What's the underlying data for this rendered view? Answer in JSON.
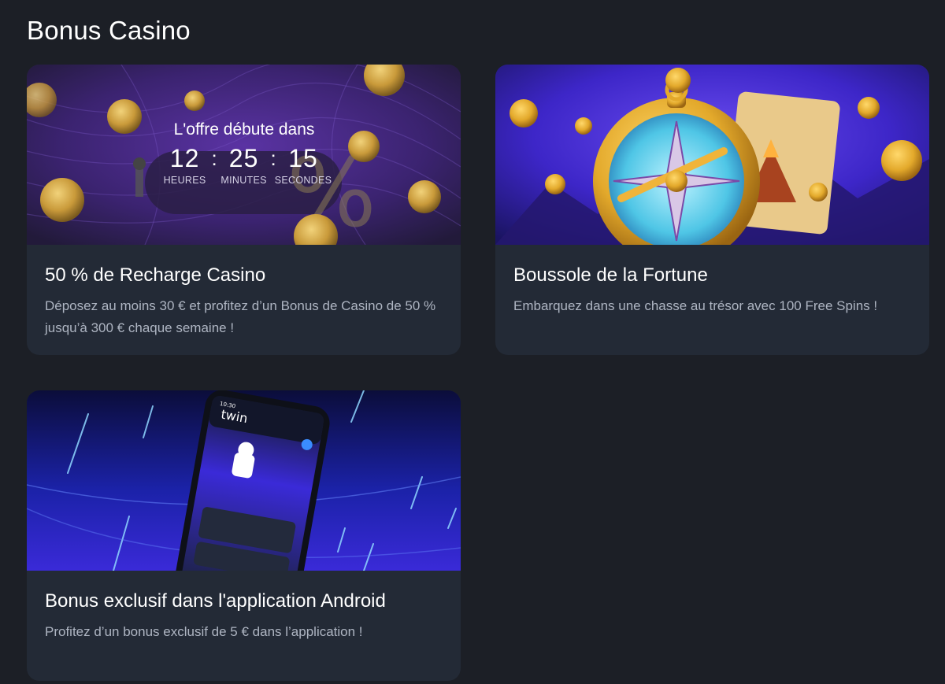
{
  "page": {
    "title": "Bonus Casino"
  },
  "cards": [
    {
      "title": "50 % de Recharge Casino",
      "description": "Déposez au moins 30 € et profitez d’un Bonus de Casino de 50 % jusqu’à 300 € chaque semaine !",
      "countdown": {
        "heading": "L'offre débute dans",
        "hours": "12",
        "minutes": "25",
        "seconds": "15",
        "hours_label": "HEURES",
        "minutes_label": "MINUTES",
        "seconds_label": "SECONDES",
        "separator": ":"
      }
    },
    {
      "title": "Boussole de la Fortune",
      "description": "Embarquez dans une chasse au trésor avec 100 Free Spins !"
    },
    {
      "title": "Bonus exclusif dans l'application Android",
      "description": "Profitez d’un bonus exclusif de 5 € dans l’application !",
      "phone": {
        "brand": "twin",
        "time": "10:30"
      }
    }
  ],
  "colors": {
    "background": "#1c1f26",
    "card": "#232a36",
    "text_muted": "#aeb5c2",
    "gold": "#e3a92b",
    "purple": "#4b2a8c",
    "blue": "#2a1fa8"
  }
}
